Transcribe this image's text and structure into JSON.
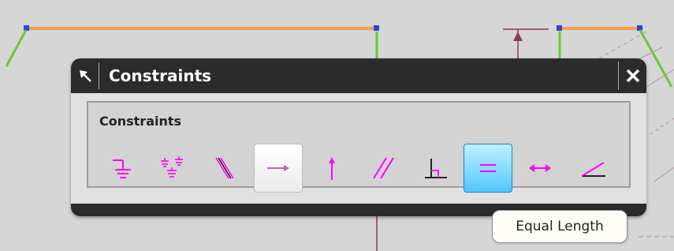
{
  "dialog": {
    "title": "Constraints",
    "group_label": "Constraints",
    "tool_icons": [
      {
        "name": "fixed-icon",
        "state": "normal"
      },
      {
        "name": "fully-fixed-icon",
        "state": "normal"
      },
      {
        "name": "coincident-icon",
        "state": "normal"
      },
      {
        "name": "horizontal-icon",
        "state": "pressed"
      },
      {
        "name": "vertical-icon",
        "state": "normal"
      },
      {
        "name": "parallel-icon",
        "state": "normal"
      },
      {
        "name": "perpendicular-icon",
        "state": "normal"
      },
      {
        "name": "equal-length-icon",
        "state": "hover"
      },
      {
        "name": "constant-length-icon",
        "state": "normal"
      },
      {
        "name": "constant-angle-icon",
        "state": "normal"
      }
    ]
  },
  "tooltip": {
    "text": "Equal Length"
  },
  "colors": {
    "icon_magenta": "#ff00ff",
    "sketch_orange": "#f0a050",
    "sketch_green": "#66cc33",
    "dimension_maroon": "#8b3a5c",
    "hover_blue": "#52c8ff"
  }
}
